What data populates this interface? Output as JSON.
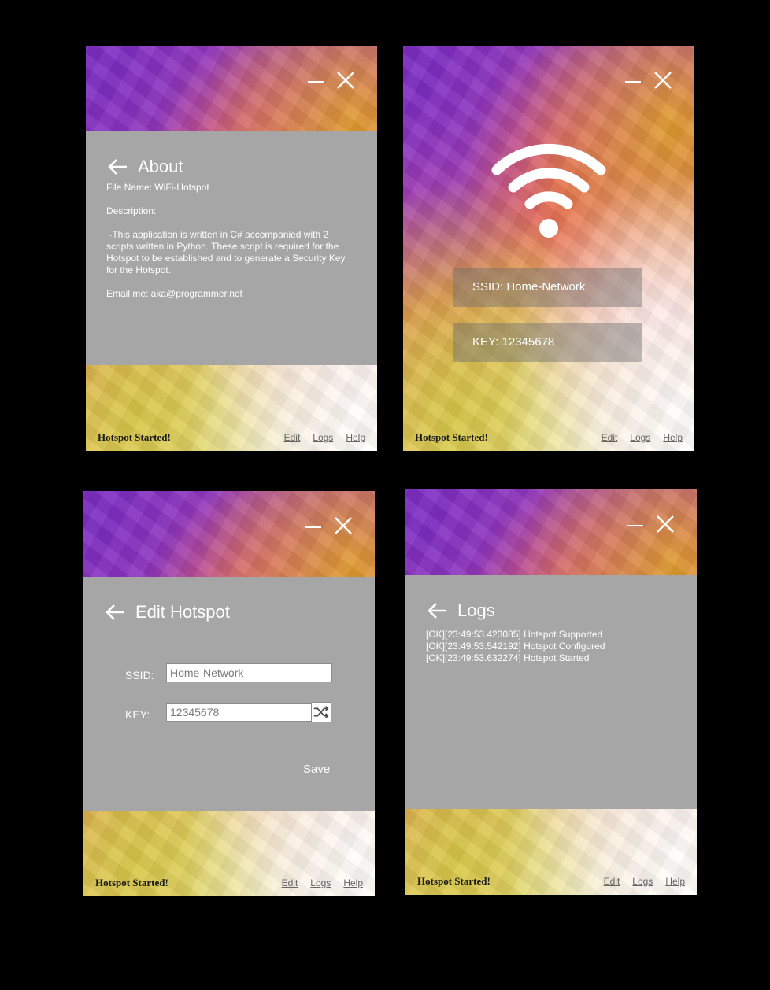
{
  "common": {
    "status": "Hotspot Started!",
    "footer_links": {
      "edit": "Edit",
      "logs": "Logs",
      "help": "Help"
    }
  },
  "about": {
    "title": "About",
    "file_name": "File Name: WiFi-Hotspot",
    "description_label": "Description:",
    "description": " -This application is written in C# accompanied with 2 scripts written in Python. These script is required for the Hotspot to be established and to generate a Security Key for the Hotspot.",
    "email": "Email me: aka@programmer.net"
  },
  "main": {
    "ssid_text": "SSID: Home-Network",
    "key_text": "KEY:  12345678"
  },
  "edit": {
    "title": "Edit Hotspot",
    "ssid_label": "SSID:",
    "ssid_value": "Home-Network",
    "key_label": "KEY:",
    "key_value": "12345678",
    "save_label": "Save"
  },
  "logs": {
    "title": "Logs",
    "lines": [
      "[OK][23:49:53.423085] Hotspot Supported",
      "[OK][23:49:53.542192] Hotspot Configured",
      "[OK][23:49:53.632274] Hotspot Started"
    ]
  }
}
